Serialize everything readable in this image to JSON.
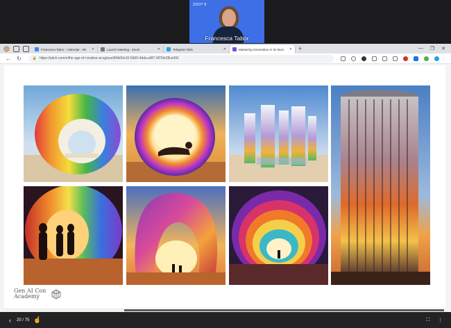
{
  "participant": {
    "tag": "ZISO* 8",
    "name": "Francesca Tabor"
  },
  "tabs": [
    {
      "label": "Francesca Tabor - Calendar - Wi",
      "favicon_color": "#4285f4"
    },
    {
      "label": "Launch Meeting - Zoom",
      "favicon_color": "#777777"
    },
    {
      "label": "Telegram Web",
      "favicon_color": "#2aa3df"
    },
    {
      "label": "Mastering Generative AI for Busi",
      "favicon_color": "#7b4be0",
      "active": true
    }
  ],
  "address": {
    "url": "https://pitch.com/v/the-age-of-creative-ai-sgtuse/84b00e10-5b60-4dda-a8f7-497bb28ca491"
  },
  "slide": {
    "images": [
      {
        "label": "rainbow-arch-desert"
      },
      {
        "label": "person-in-glowing-ring"
      },
      {
        "label": "glass-pillars-desert"
      },
      {
        "label": "tall-glass-column-tower"
      },
      {
        "label": "rainbow-tunnel-silhouettes"
      },
      {
        "label": "wavy-arch-sunset"
      },
      {
        "label": "concentric-arch-tunnel"
      }
    ],
    "logo": {
      "line1": "Gen AI Con",
      "line2": "Academy"
    }
  },
  "player": {
    "counter": "20 / 75",
    "progress": 0.27
  }
}
